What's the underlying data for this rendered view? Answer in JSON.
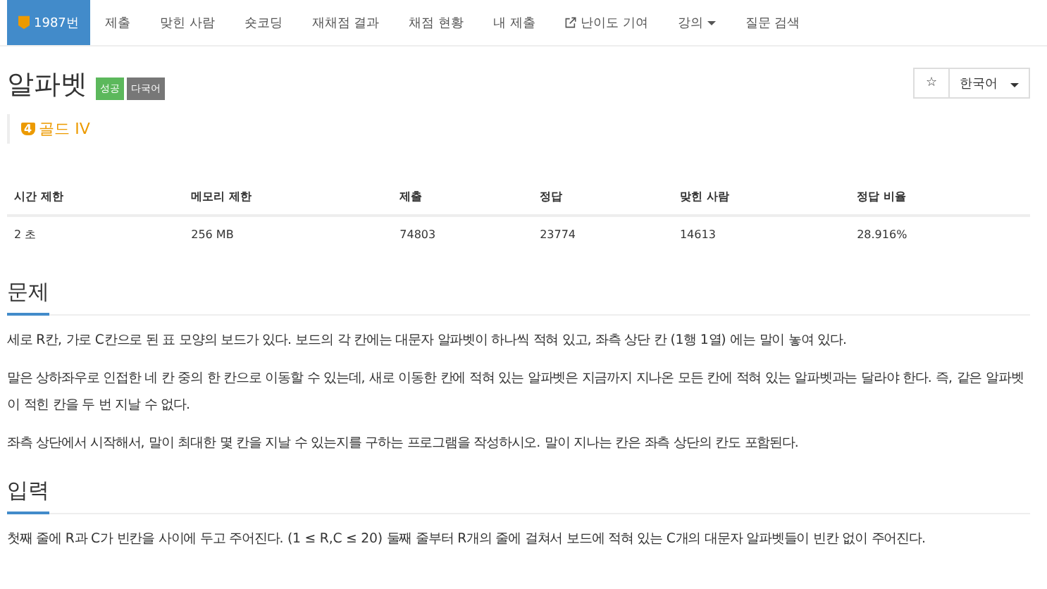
{
  "nav": [
    {
      "label": "1987번",
      "selected": true,
      "kind": "tier"
    },
    {
      "label": "제출",
      "selected": false,
      "kind": "plain"
    },
    {
      "label": "맞힌 사람",
      "selected": false,
      "kind": "plain"
    },
    {
      "label": "숏코딩",
      "selected": false,
      "kind": "plain"
    },
    {
      "label": "재채점 결과",
      "selected": false,
      "kind": "plain"
    },
    {
      "label": "채점 현황",
      "selected": false,
      "kind": "plain"
    },
    {
      "label": "내 제출",
      "selected": false,
      "kind": "plain"
    },
    {
      "label": "난이도 기여",
      "selected": false,
      "kind": "external"
    },
    {
      "label": "강의",
      "selected": false,
      "kind": "dropdown"
    },
    {
      "label": "질문 검색",
      "selected": false,
      "kind": "plain"
    }
  ],
  "title": "알파벳",
  "badges": [
    {
      "label": "성공",
      "color": "#5cb85c"
    },
    {
      "label": "다국어",
      "color": "#777777"
    }
  ],
  "tier": {
    "number": "4",
    "label": "골드 IV"
  },
  "star_button": "☆",
  "language": "한국어",
  "table": {
    "columns": [
      "시간 제한",
      "메모리 제한",
      "제출",
      "정답",
      "맞힌 사람",
      "정답 비율"
    ],
    "rows": [
      [
        "2 초",
        "256 MB",
        "74803",
        "23774",
        "14613",
        "28.916%"
      ]
    ]
  },
  "sections": [
    {
      "heading": "문제",
      "paragraphs": [
        "세로 R칸, 가로 C칸으로 된 표 모양의 보드가 있다. 보드의 각 칸에는 대문자 알파벳이 하나씩 적혀 있고, 좌측 상단 칸 (1행 1열) 에는 말이 놓여 있다.",
        "말은 상하좌우로 인접한 네 칸 중의 한 칸으로 이동할 수 있는데, 새로 이동한 칸에 적혀 있는 알파벳은 지금까지 지나온 모든 칸에 적혀 있는 알파벳과는 달라야 한다. 즉, 같은 알파벳이 적힌 칸을 두 번 지날 수 없다.",
        "좌측 상단에서 시작해서, 말이 최대한 몇 칸을 지날 수 있는지를 구하는 프로그램을 작성하시오. 말이 지나는 칸은 좌측 상단의 칸도 포함된다."
      ]
    },
    {
      "heading": "입력",
      "paragraphs": [
        "첫째 줄에 R과 C가 빈칸을 사이에 두고 주어진다. (1 ≤ R,C ≤ 20) 둘째 줄부터 R개의 줄에 걸쳐서 보드에 적혀 있는 C개의 대문자 알파벳들이 빈칸 없이 주어진다."
      ]
    }
  ]
}
